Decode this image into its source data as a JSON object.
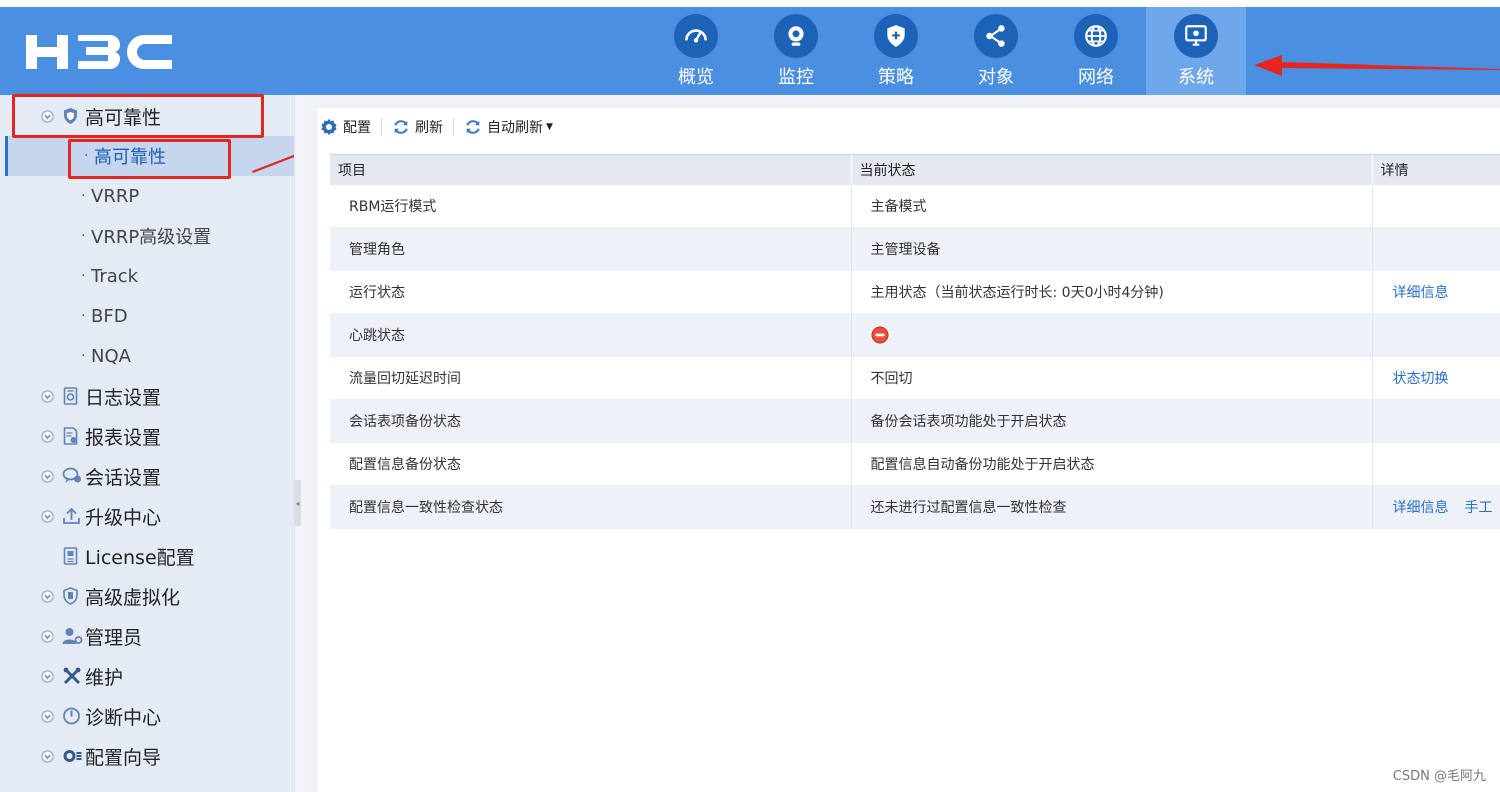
{
  "brand": {
    "logo_text": "H3C"
  },
  "nav": [
    {
      "label": "概览",
      "icon": "dashboard-icon",
      "active": false
    },
    {
      "label": "监控",
      "icon": "camera-icon",
      "active": false
    },
    {
      "label": "策略",
      "icon": "shield-icon",
      "active": false
    },
    {
      "label": "对象",
      "icon": "share-icon",
      "active": false
    },
    {
      "label": "网络",
      "icon": "globe-icon",
      "active": false
    },
    {
      "label": "系统",
      "icon": "monitor-icon",
      "active": true
    }
  ],
  "sidebar": {
    "active_group": "高可靠性",
    "active_group_icon": "shield-icon",
    "sub_items": [
      {
        "label": "高可靠性",
        "active": true
      },
      {
        "label": "VRRP",
        "active": false
      },
      {
        "label": "VRRP高级设置",
        "active": false
      },
      {
        "label": "Track",
        "active": false
      },
      {
        "label": "BFD",
        "active": false
      },
      {
        "label": "NQA",
        "active": false
      }
    ],
    "groups": [
      {
        "label": "日志设置",
        "icon": "log-icon",
        "chevron": true
      },
      {
        "label": "报表设置",
        "icon": "report-icon",
        "chevron": true
      },
      {
        "label": "会话设置",
        "icon": "session-icon",
        "chevron": true
      },
      {
        "label": "升级中心",
        "icon": "upload-icon",
        "chevron": true
      },
      {
        "label": "License配置",
        "icon": "license-icon",
        "chevron": false
      },
      {
        "label": "高级虚拟化",
        "icon": "virtual-icon",
        "chevron": true
      },
      {
        "label": "管理员",
        "icon": "admin-icon",
        "chevron": true
      },
      {
        "label": "维护",
        "icon": "tools-icon",
        "chevron": true
      },
      {
        "label": "诊断中心",
        "icon": "diagnosis-icon",
        "chevron": true
      },
      {
        "label": "配置向导",
        "icon": "wizard-icon",
        "chevron": true
      }
    ]
  },
  "toolbar": {
    "config": "配置",
    "refresh": "刷新",
    "auto_refresh": "自动刷新"
  },
  "table": {
    "headers": [
      "项目",
      "当前状态",
      "详情"
    ],
    "rows": [
      {
        "item": "RBM运行模式",
        "status": "主备模式",
        "links": []
      },
      {
        "item": "管理角色",
        "status": "主管理设备",
        "links": []
      },
      {
        "item": "运行状态",
        "status": "主用状态（当前状态运行时长: 0天0小时4分钟)",
        "links": [
          "详细信息"
        ]
      },
      {
        "item": "心跳状态",
        "status": "",
        "status_icon": "error-icon",
        "links": []
      },
      {
        "item": "流量回切延迟时间",
        "status": "不回切",
        "links": [
          "状态切换"
        ]
      },
      {
        "item": "会话表项备份状态",
        "status": "备份会话表项功能处于开启状态",
        "links": []
      },
      {
        "item": "配置信息备份状态",
        "status": "配置信息自动备份功能处于开启状态",
        "links": []
      },
      {
        "item": "配置信息一致性检查状态",
        "status": "还未进行过配置信息一致性检查",
        "links": [
          "详细信息",
          "手工"
        ]
      }
    ]
  },
  "watermark": "CSDN @毛阿九",
  "colors": {
    "header": "#4a8fe0",
    "nav_circle": "#1c63b8",
    "annotation": "#e4261f",
    "link": "#2a6fc9"
  }
}
